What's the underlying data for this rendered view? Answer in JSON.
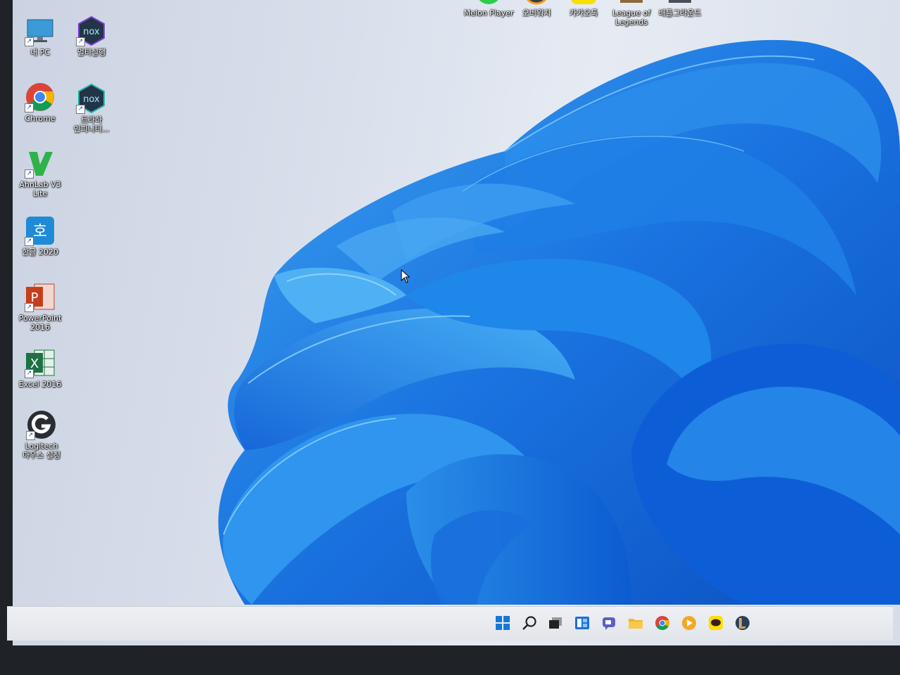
{
  "desktop": {
    "left_icons": [
      {
        "label": "내 PC",
        "icon": "monitor-icon"
      },
      {
        "label": "멀티실행",
        "icon": "nox-icon"
      },
      {
        "label": "Chrome",
        "icon": "chrome-icon"
      },
      {
        "label": "트라하\n인피니티...",
        "icon": "nox-icon"
      },
      {
        "label": "AhnLab V3\nLite",
        "icon": "ahnlab-icon"
      },
      {
        "label": "한글 2020",
        "icon": "hangul-icon"
      },
      {
        "label": "PowerPoint\n2016",
        "icon": "powerpoint-icon"
      },
      {
        "label": "Excel 2016",
        "icon": "excel-icon"
      },
      {
        "label": "Logitech\n마우스 설정",
        "icon": "logitech-icon"
      }
    ],
    "top_icons": [
      {
        "label": "Melon Player"
      },
      {
        "label": "오버워치"
      },
      {
        "label": "카카오톡"
      },
      {
        "label": "League of\nLegends"
      },
      {
        "label": "배틀그라운드"
      }
    ]
  },
  "taskbar": {
    "items": [
      {
        "icon": "windows-start-icon",
        "color": "#1677d8"
      },
      {
        "icon": "search-icon",
        "color": "#222222"
      },
      {
        "icon": "task-view-icon",
        "color": "#222222"
      },
      {
        "icon": "widgets-icon",
        "color": "#1f6fd0"
      },
      {
        "icon": "teams-chat-icon",
        "color": "#5b5fc7"
      },
      {
        "icon": "file-explorer-icon",
        "color": "#f2b52e"
      },
      {
        "icon": "chrome-icon",
        "color": "#db4437"
      },
      {
        "icon": "media-player-icon",
        "color": "#f5a623"
      },
      {
        "icon": "kakaotalk-icon",
        "color": "#f9e000"
      },
      {
        "icon": "league-of-legends-icon",
        "color": "#2b3f5c"
      }
    ]
  },
  "colors": {
    "wallpaper_blue": "#1a73e0",
    "wallpaper_light": "#3fa4f0",
    "wallpaper_dark": "#0b4fc0"
  }
}
